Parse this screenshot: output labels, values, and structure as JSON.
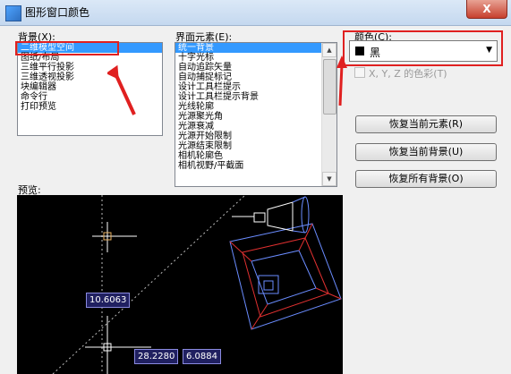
{
  "window": {
    "title": "图形窗口颜色",
    "close_glyph": "X"
  },
  "context": {
    "label": "背景(X):",
    "items": [
      "二维模型空间",
      "图纸/布局",
      "三维平行投影",
      "三维透视投影",
      "块编辑器",
      "命令行",
      "打印预览"
    ],
    "selected_index": 0
  },
  "interface_element": {
    "label": "界面元素(E):",
    "items": [
      "统一背景",
      "十字光标",
      "自动追踪矢量",
      "自动捕捉标记",
      "设计工具栏提示",
      "设计工具栏提示背景",
      "光线轮廓",
      "光源聚光角",
      "光源衰减",
      "光源开始限制",
      "光源结束限制",
      "相机轮廓色",
      "相机视野/平截面"
    ],
    "selected_index": 0
  },
  "color": {
    "label": "颜色(C):",
    "selected": "黑",
    "swatch_color": "#000000"
  },
  "xyz_tint": {
    "label": "X, Y, Z 的色彩(T)",
    "checked": false,
    "enabled": false
  },
  "buttons": {
    "restore_element": "恢复当前元素(R)",
    "restore_context": "恢复当前背景(U)",
    "restore_all": "恢复所有背景(O)"
  },
  "preview": {
    "label": "预览:",
    "dims": {
      "vertical": "10.6063",
      "horizontal": "28.2280",
      "secondary": "6.0884"
    }
  },
  "annotation_color": "#e02020",
  "accent_color": "#3399ff"
}
